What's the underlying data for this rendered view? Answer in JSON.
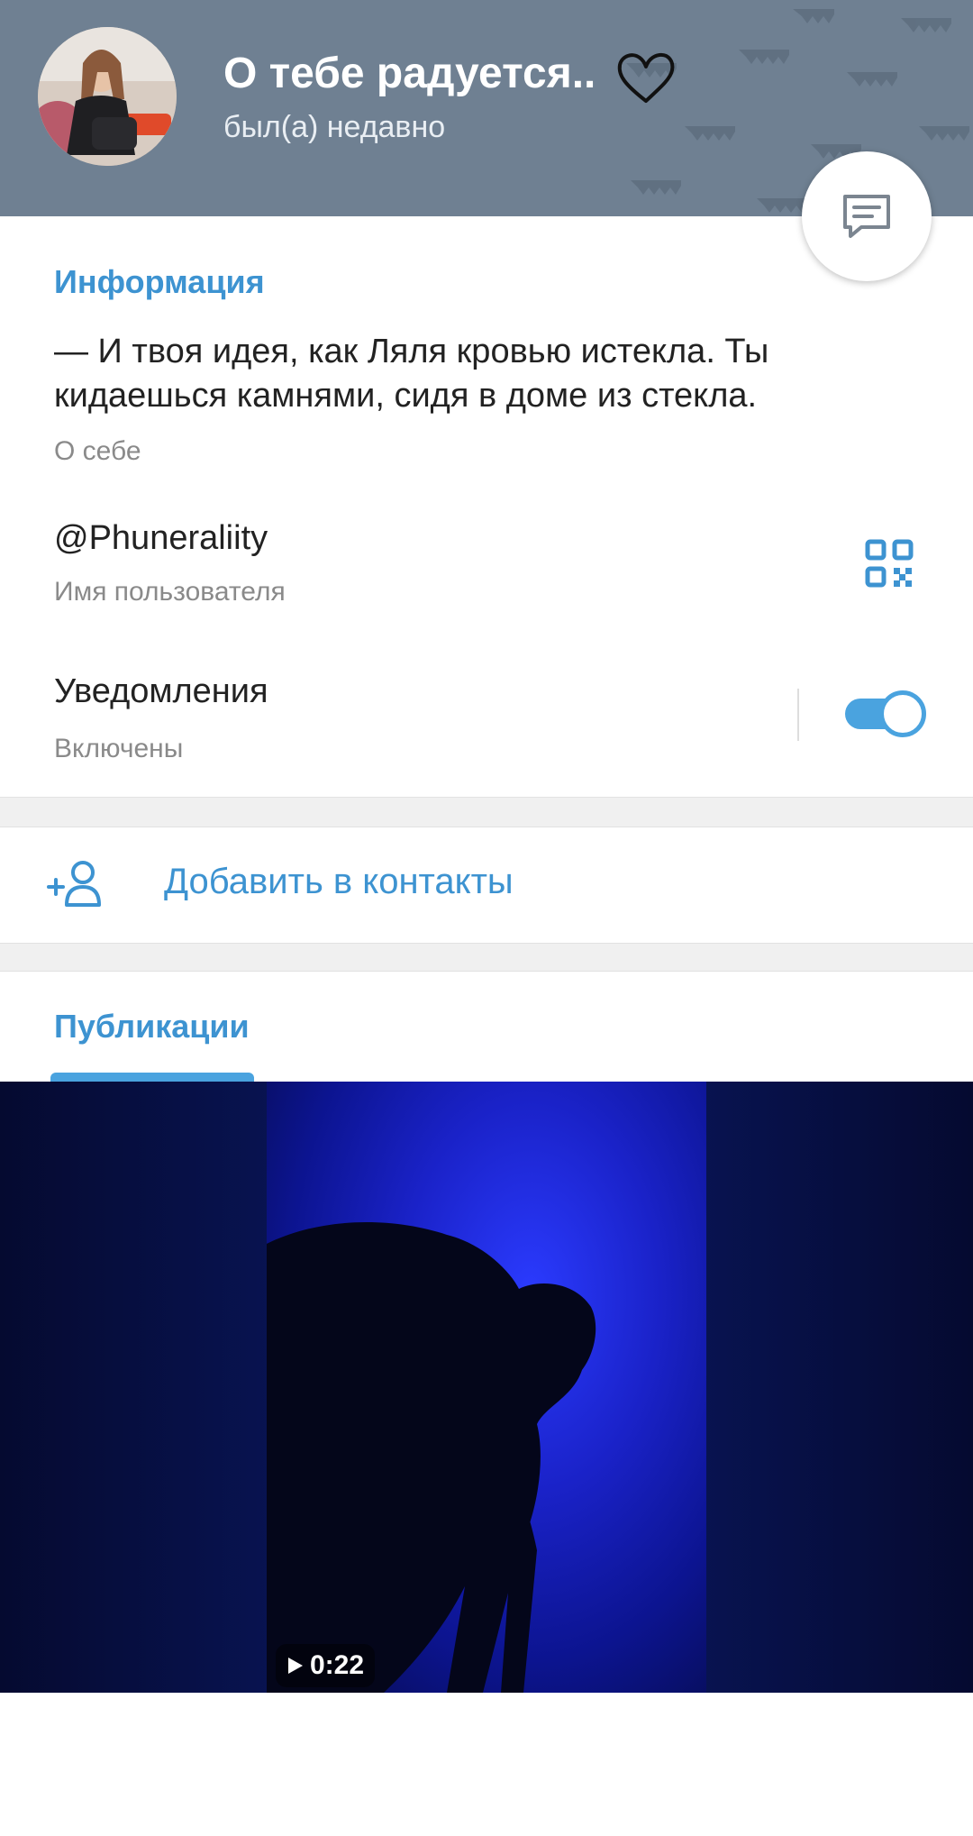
{
  "header": {
    "title": "О тебе радуется..",
    "status": "был(а) недавно",
    "header_color": "#6f8092"
  },
  "info": {
    "section_label": "Информация",
    "bio": "— И твоя идея, как Ляля кровью истекла. Ты кидаешься камнями, сидя в доме из стекла.",
    "bio_label": "О себе",
    "username": "@Phuneraliity",
    "username_label": "Имя пользователя",
    "notifications": "Уведомления",
    "notifications_status": "Включены",
    "notifications_enabled": true
  },
  "actions": {
    "add_contact": "Добавить в контакты"
  },
  "tabs": {
    "publications": "Публикации"
  },
  "media": {
    "duration": "0:22"
  },
  "colors": {
    "accent": "#3d93d1",
    "toggle": "#4aa3df"
  }
}
